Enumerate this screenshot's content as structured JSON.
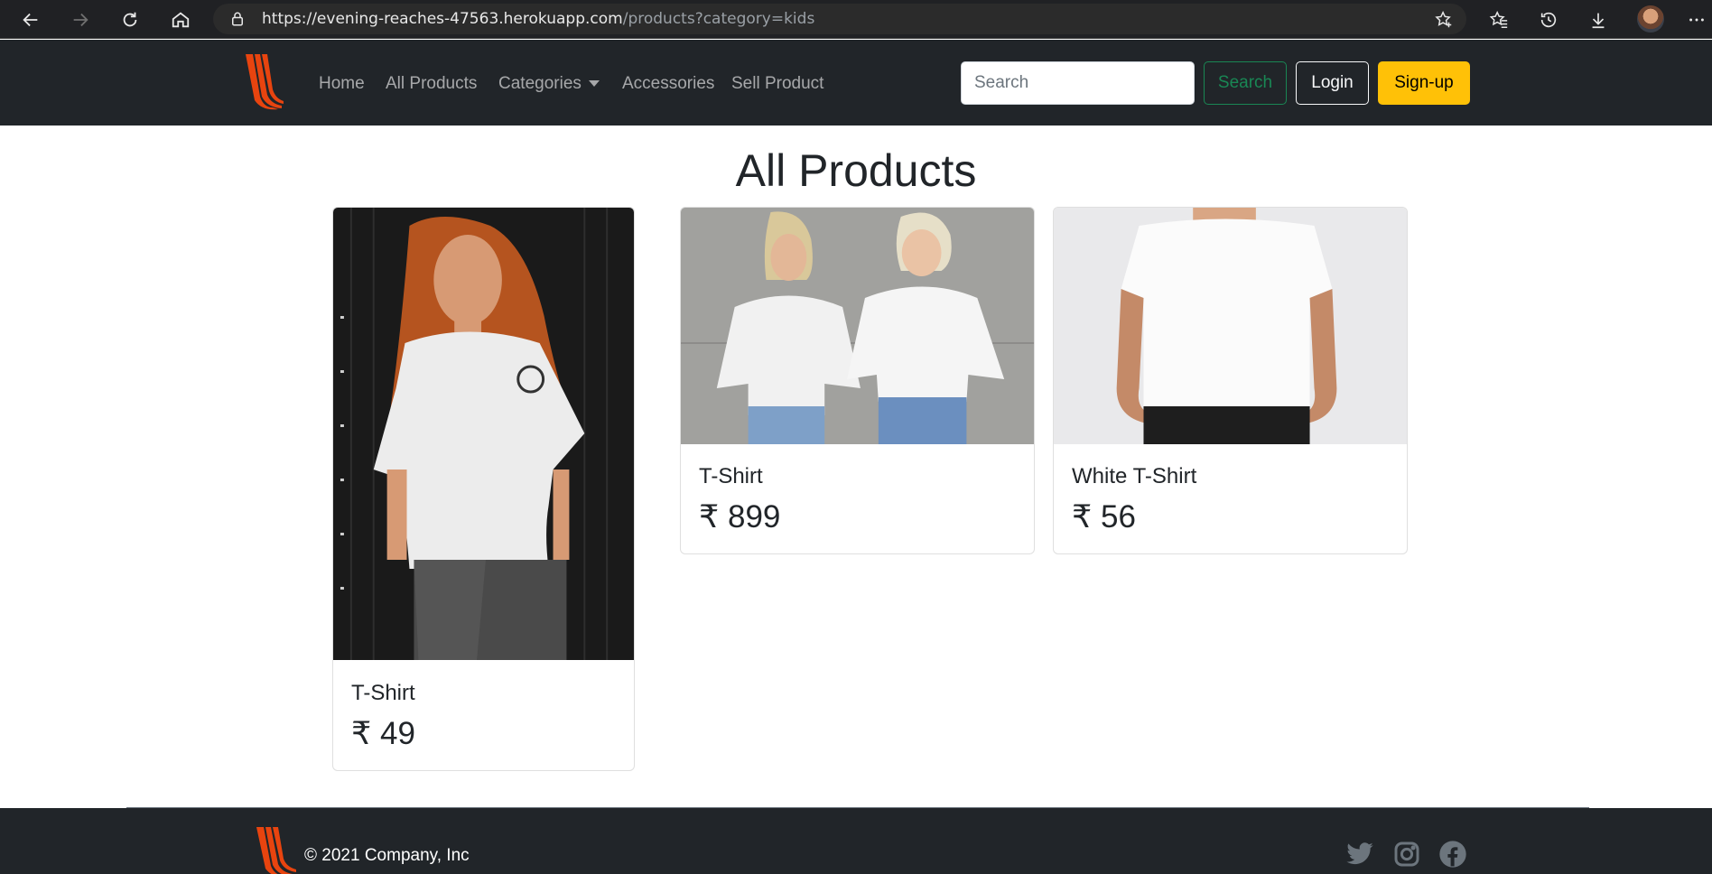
{
  "browser": {
    "url_host": "https://evening-reaches-47563.herokuapp.com",
    "url_rest": "/products?category=kids",
    "icons": [
      "back-icon",
      "forward-icon",
      "reload-icon",
      "home-icon",
      "lock-icon",
      "add-favorite-icon",
      "favorites-icon",
      "history-icon",
      "download-icon",
      "profile-avatar",
      "more-icon"
    ]
  },
  "navbar": {
    "links": [
      "Home",
      "All Products",
      "Categories",
      "Accessories",
      "Sell Product"
    ],
    "search_placeholder": "Search",
    "search_button": "Search",
    "login_button": "Login",
    "signup_button": "Sign-up"
  },
  "main": {
    "title": "All Products",
    "products": [
      {
        "name": "T-Shirt",
        "price": "₹ 49"
      },
      {
        "name": "T-Shirt",
        "price": "₹ 899"
      },
      {
        "name": "White T-Shirt",
        "price": "₹ 56"
      }
    ]
  },
  "footer": {
    "copyright": "© 2021 Company, Inc",
    "social_icons": [
      "twitter-icon",
      "instagram-icon",
      "facebook-icon"
    ]
  },
  "colors": {
    "navbar_bg": "#212529",
    "search_button": "#198754",
    "signup_button": "#ffc107",
    "logo_orange": "#e8440f"
  }
}
